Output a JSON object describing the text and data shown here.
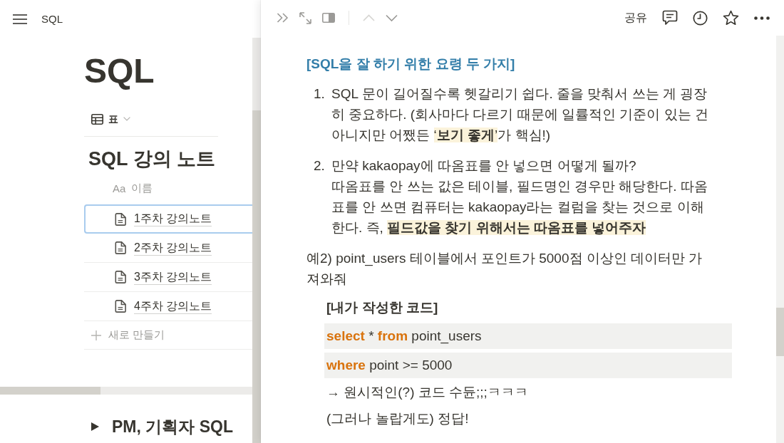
{
  "left_page": {
    "breadcrumb": "SQL",
    "title": "SQL",
    "view": {
      "label": "표"
    },
    "database": {
      "title": "SQL 강의 노트",
      "column_header": {
        "type_text": "Aa",
        "label": "이름"
      },
      "rows": [
        {
          "title": "1주차 강의노트",
          "selected": true
        },
        {
          "title": "2주차 강의노트",
          "selected": false
        },
        {
          "title": "3주차 강의노트",
          "selected": false
        },
        {
          "title": "4주차 강의노트",
          "selected": false
        }
      ],
      "new_row_label": "새로 만들기"
    },
    "toggle": {
      "title": "PM, 기획자 SQL",
      "expanded": false
    }
  },
  "peek": {
    "toolbar": {
      "nav": [
        {
          "kind": "up",
          "disabled": true
        },
        {
          "kind": "down",
          "disabled": false
        }
      ],
      "share_label": "공유"
    },
    "blocks": [
      {
        "kind": "heading",
        "text": "[SQL을 잘 하기 위한 요령 두 가지]"
      },
      {
        "kind": "numbered",
        "number": "1.",
        "segments": [
          {
            "text": "SQL 문이 길어질수록 헷갈리기 쉽다. 줄을 맞춰서 쓰는 게 굉장히 중요하다. (회사마다 다르기 때문에 일률적인 기준이 있는 건 아니지만 어쨌든 ",
            "highlight": false
          },
          {
            "text": "‘**보기 좋게**’",
            "highlight": true
          },
          {
            "text": "가 핵심!)",
            "highlight": false
          }
        ]
      },
      {
        "kind": "numbered",
        "number": "2.",
        "segments": [
          {
            "text": "만약 kakaopay에 따옴표를 안 넣으면 어떻게 될까?\n따옴표를 안 쓰는 값은 테이블, 필드명인 경우만 해당한다. 따옴표를 안 쓰면 컴퓨터는 kakaopay라는 컬럼을 찾는 것으로 이해한다. 즉, ",
            "highlight": false
          },
          {
            "text": "**필드값을 찾기 위해서는 따옴표를 넣어주자**",
            "highlight": true
          }
        ]
      },
      {
        "kind": "paragraph",
        "bold": false,
        "segments": [
          {
            "text": "예2) point_users 테이블에서 포인트가 5000점 이상인 데이터만 가져와줘",
            "highlight": false
          }
        ],
        "children": [
          {
            "kind": "paragraph",
            "bold": true,
            "segments": [
              {
                "text": "[내가 작성한 코드]",
                "highlight": false
              }
            ]
          },
          {
            "kind": "code",
            "tokens": [
              {
                "text": "select",
                "keyword": true
              },
              {
                "text": " * ",
                "keyword": false
              },
              {
                "text": "from",
                "keyword": true
              },
              {
                "text": " point_users",
                "keyword": false
              }
            ]
          },
          {
            "kind": "code",
            "tokens": [
              {
                "text": "where",
                "keyword": true
              },
              {
                "text": " point >= 5000",
                "keyword": false
              }
            ]
          },
          {
            "kind": "paragraph",
            "bold": false,
            "segments": [
              {
                "text": "→ 원시적인(?) 코드 수듄;;;ㅋㅋㅋ",
                "highlight": false
              }
            ]
          },
          {
            "kind": "paragraph",
            "bold": false,
            "segments": [
              {
                "text": "(그러나 놀랍게도) 정답!",
                "highlight": false
              }
            ]
          }
        ]
      }
    ]
  }
}
